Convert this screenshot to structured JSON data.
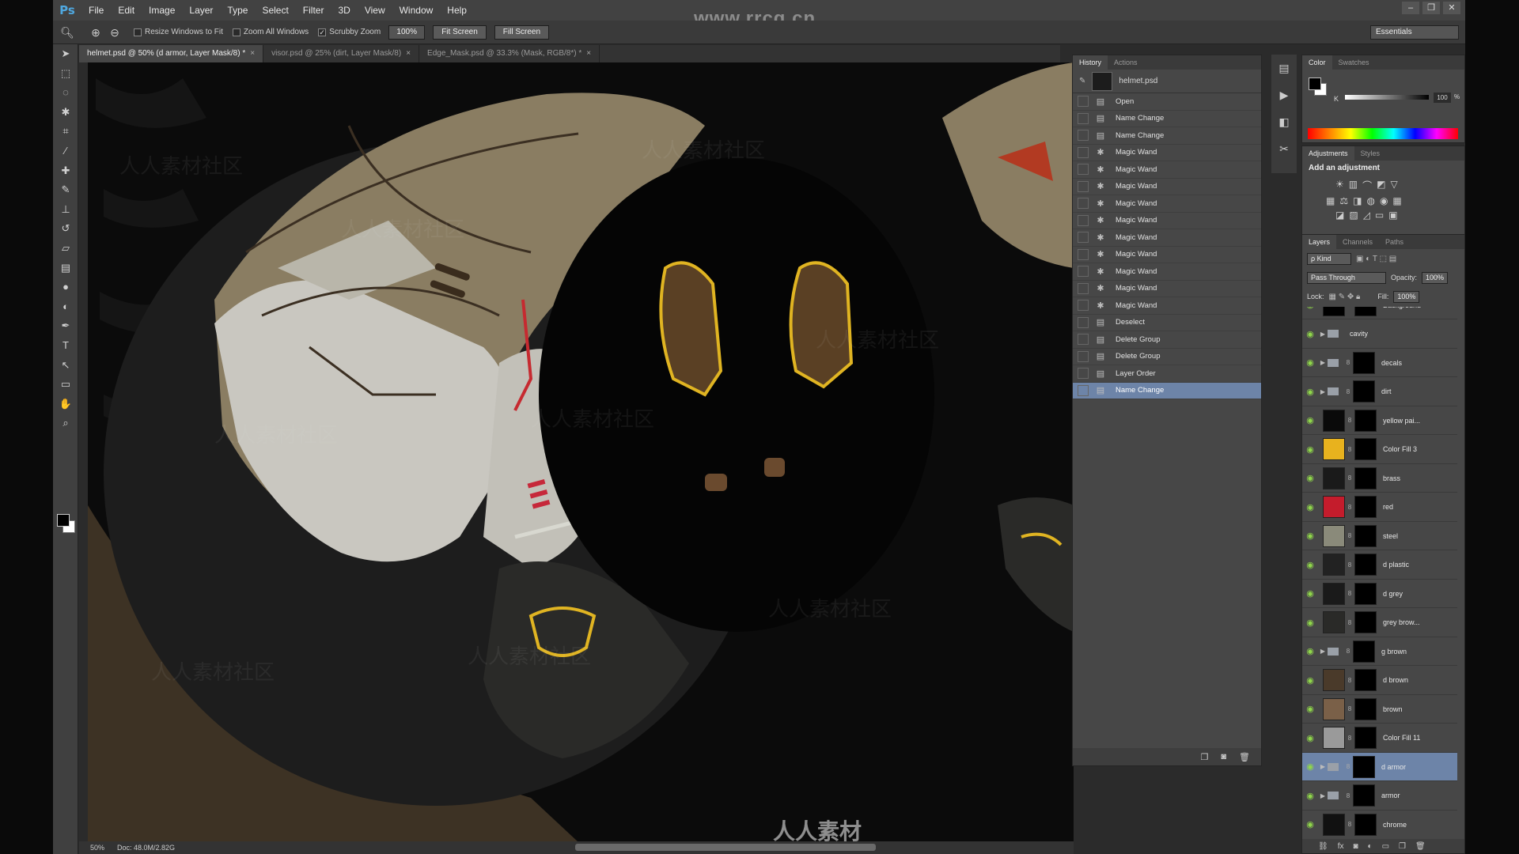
{
  "app": {
    "logo": "Ps",
    "menu": [
      "File",
      "Edit",
      "Image",
      "Layer",
      "Type",
      "Select",
      "Filter",
      "3D",
      "View",
      "Window",
      "Help"
    ],
    "watermark_url": "www.rrcg.cn",
    "bottom_watermark": "人人素材",
    "window_controls": [
      "–",
      "❐",
      "✕"
    ]
  },
  "options_bar": {
    "resize_windows": "Resize Windows to Fit",
    "zoom_all": "Zoom All Windows",
    "scrubby_zoom": "Scrubby Zoom",
    "zoom_value": "100%",
    "fit_screen": "Fit Screen",
    "fill_screen": "Fill Screen",
    "workspace": "Essentials"
  },
  "tabs": [
    {
      "label": "helmet.psd @ 50% (d armor, Layer Mask/8) *",
      "active": true
    },
    {
      "label": "visor.psd @ 25% (dirt, Layer Mask/8)",
      "active": false
    },
    {
      "label": "Edge_Mask.psd @ 33.3% (Mask, RGB/8*) *",
      "active": false
    }
  ],
  "status": {
    "zoom": "50%",
    "doc": "Doc: 48.0M/2.82G"
  },
  "history": {
    "tabs": [
      "History",
      "Actions"
    ],
    "snapshot": "helmet.psd",
    "items": [
      {
        "label": "Open",
        "icon": "doc-icon"
      },
      {
        "label": "Name Change",
        "icon": "doc-icon"
      },
      {
        "label": "Name Change",
        "icon": "doc-icon"
      },
      {
        "label": "Magic Wand",
        "icon": "wand-icon"
      },
      {
        "label": "Magic Wand",
        "icon": "wand-icon"
      },
      {
        "label": "Magic Wand",
        "icon": "wand-icon"
      },
      {
        "label": "Magic Wand",
        "icon": "wand-icon"
      },
      {
        "label": "Magic Wand",
        "icon": "wand-icon"
      },
      {
        "label": "Magic Wand",
        "icon": "wand-icon"
      },
      {
        "label": "Magic Wand",
        "icon": "wand-icon"
      },
      {
        "label": "Magic Wand",
        "icon": "wand-icon"
      },
      {
        "label": "Magic Wand",
        "icon": "wand-icon"
      },
      {
        "label": "Magic Wand",
        "icon": "wand-icon"
      },
      {
        "label": "Deselect",
        "icon": "doc-icon"
      },
      {
        "label": "Delete Group",
        "icon": "doc-icon"
      },
      {
        "label": "Delete Group",
        "icon": "doc-icon"
      },
      {
        "label": "Layer Order",
        "icon": "doc-icon"
      },
      {
        "label": "Name Change",
        "icon": "doc-icon",
        "selected": true
      }
    ]
  },
  "color_panel": {
    "tabs": [
      "Color",
      "Swatches"
    ],
    "k_label": "K",
    "k_value": "100",
    "k_unit": "%"
  },
  "adjustments": {
    "tabs": [
      "Adjustments",
      "Styles"
    ],
    "title": "Add an adjustment"
  },
  "layers": {
    "tabs": [
      "Layers",
      "Channels",
      "Paths"
    ],
    "kind": "ρ Kind",
    "blend_mode": "Pass Through",
    "opacity_label": "Opacity:",
    "opacity": "100%",
    "lock_label": "Lock:",
    "fill_label": "Fill:",
    "fill": "100%",
    "items": [
      {
        "name": "Background",
        "group": false,
        "color": "#000000",
        "selected": false
      },
      {
        "name": "cavity",
        "group": true,
        "color": "",
        "selected": false
      },
      {
        "name": "decals",
        "group": true,
        "color": "#000000",
        "selected": false
      },
      {
        "name": "dirt",
        "group": true,
        "color": "#000000",
        "selected": false
      },
      {
        "name": "yellow pai...",
        "group": false,
        "color": "#0a0a0a",
        "selected": false
      },
      {
        "name": "Color Fill 3",
        "group": false,
        "color": "#e8b21e",
        "selected": false
      },
      {
        "name": "brass",
        "group": false,
        "color": "#1a1a1a",
        "selected": false
      },
      {
        "name": "red",
        "group": false,
        "color": "#c41c2c",
        "selected": false
      },
      {
        "name": "steel",
        "group": false,
        "color": "#8a8a7a",
        "selected": false
      },
      {
        "name": "d plastic",
        "group": false,
        "color": "#222222",
        "selected": false
      },
      {
        "name": "d grey",
        "group": false,
        "color": "#1a1a1a",
        "selected": false
      },
      {
        "name": "grey brow...",
        "group": false,
        "color": "#2a2a28",
        "selected": false
      },
      {
        "name": "g brown",
        "group": true,
        "color": "#000000",
        "selected": false
      },
      {
        "name": "d brown",
        "group": false,
        "color": "#4a3a2a",
        "selected": false
      },
      {
        "name": "brown",
        "group": false,
        "color": "#7a6048",
        "selected": false
      },
      {
        "name": "Color Fill 11",
        "group": false,
        "color": "#9a9a9a",
        "selected": false
      },
      {
        "name": "d armor",
        "group": true,
        "color": "#000000",
        "selected": true
      },
      {
        "name": "armor",
        "group": true,
        "color": "#000000",
        "selected": false
      },
      {
        "name": "chrome",
        "group": false,
        "color": "#111111",
        "selected": false
      }
    ]
  },
  "colors": {
    "selection": "#6d84a8",
    "eye": "#8fd64a",
    "texture_tan": "#8a7d62",
    "texture_light": "#c9c7c0"
  }
}
